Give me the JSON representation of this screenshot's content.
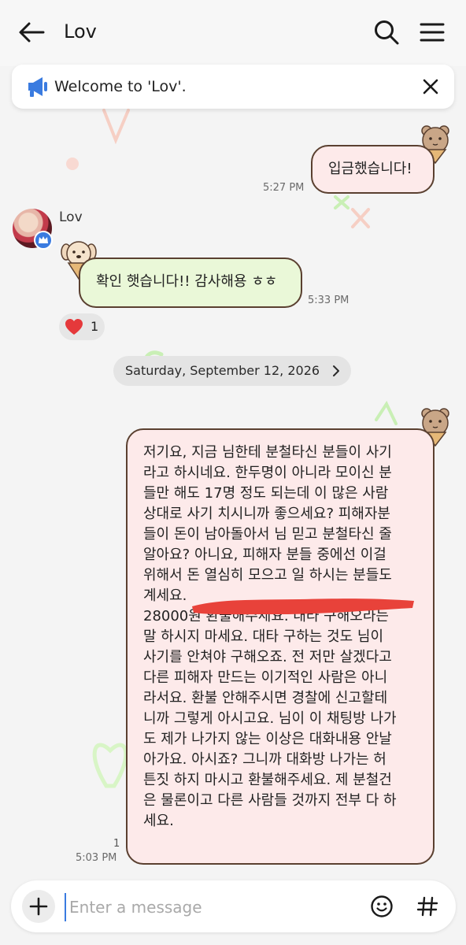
{
  "header": {
    "title": "Lov"
  },
  "notice": {
    "text": "Welcome to 'Lov'."
  },
  "messages": {
    "m1": {
      "text": "입금했습니다!",
      "time": "5:27 PM"
    },
    "m2": {
      "sender": "Lov",
      "text": "확인 햇습니다!! 감사해용 ㅎㅎ",
      "time": "5:33 PM",
      "reaction": {
        "emoji": "heart",
        "count": "1"
      }
    },
    "date_divider": "Saturday, September 12, 2026",
    "m3": {
      "lines": [
        "저기요, 지금 님한테 분철타신 분들이 사기",
        "라고 하시네요. 한두명이 아니라 모이신 분",
        "들만 해도 17명 정도 되는데 이 많은 사람",
        "상대로 사기 치시니까 좋으세요? 피해자분",
        "들이 돈이 남아돌아서 님 믿고 분철타신 줄",
        "알아요? 아니요, 피해자 분들 중에선 이걸",
        "위해서 돈 열심히 모으고 일 하시는 분들도",
        "계세요.",
        "28000원 환불해주세요. 대타 구해오라는",
        "말 하시지 마세요. 대타 구하는 것도 님이",
        "사기를 안쳐야 구해오죠. 전 저만 살겠다고",
        "다른 피해자 만드는 이기적인 사람은 아니",
        "라서요. 환불 안해주시면 경찰에 신고할테",
        "니까 그렇게 아시고요. 님이 이 채팅방 나가",
        "도 제가 나가지 않는 이상은 대화내용 안날",
        "아가요. 아시죠? 그니까 대화방 나가는 허",
        "튼짓 하지 마시고 환불해주세요. 제 분철건",
        "은 물론이고 다른 사람들 것까지 전부 다 하",
        "세요."
      ],
      "read_count": "1",
      "time": "5:03 PM"
    }
  },
  "input": {
    "placeholder": "Enter a message"
  },
  "icons": {
    "back": "back-arrow-icon",
    "search": "search-icon",
    "menu": "hamburger-menu-icon",
    "notice": "megaphone-icon",
    "close": "close-icon",
    "plus": "plus-icon",
    "emoji": "emoji-icon",
    "hash": "hashtag-icon",
    "chevron": "chevron-right-icon"
  },
  "colors": {
    "outgoing_bubble": "#fdeaea",
    "incoming_bubble": "#eaf8d8",
    "bubble_border": "#5a4030",
    "accent": "#3a7be0",
    "redaction": "#e8423a"
  }
}
